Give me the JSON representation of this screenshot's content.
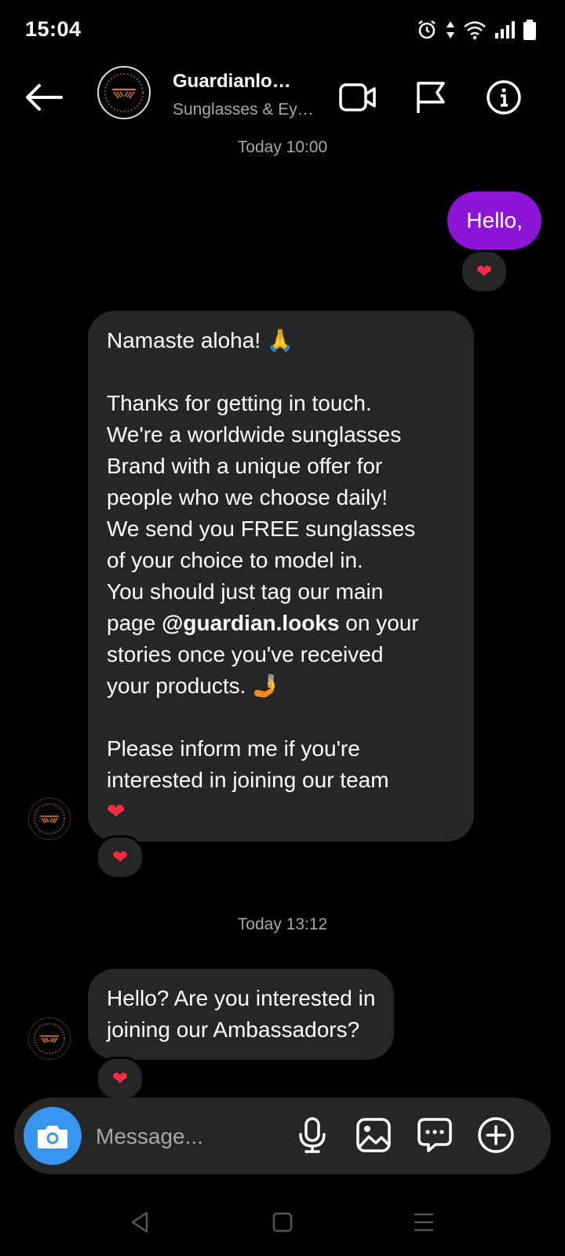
{
  "status_bar": {
    "time": "15:04"
  },
  "header": {
    "name": "Guardianlo…",
    "subtitle": "Sunglasses & Ey…",
    "avatar_text": "GUARDIANLOOKS"
  },
  "messages": {
    "timestamp_1": "Today 10:00",
    "outgoing_1": "Hello,",
    "reaction_heart": "❤",
    "incoming_1": {
      "greeting": "Namaste aloha! 🙏",
      "lines": [
        "Thanks for getting in touch.",
        "We're a worldwide sunglasses",
        "Brand with a unique offer for",
        "people who we choose daily!",
        "We send you FREE sunglasses",
        "of your choice to model in.",
        "You should just tag our main"
      ],
      "tag_prefix": "page ",
      "tag_handle": "@guardian.looks",
      "tag_suffix": " on your",
      "line_after_tag": "stories once you've received",
      "line_products": "your products. 🤳",
      "closing_1": "Please inform me if you're",
      "closing_2": "interested in joining our team",
      "closing_heart": "❤"
    },
    "timestamp_2": "Today 13:12",
    "incoming_2": {
      "line_1": "Hello? Are you interested in",
      "line_2": "joining our Ambassadors?"
    }
  },
  "composer": {
    "placeholder": "Message..."
  },
  "colors": {
    "outgoing_bubble": "#8c15d8",
    "incoming_bubble": "#262626",
    "camera_button": "#3797f0",
    "heart": "#ff2d43"
  }
}
